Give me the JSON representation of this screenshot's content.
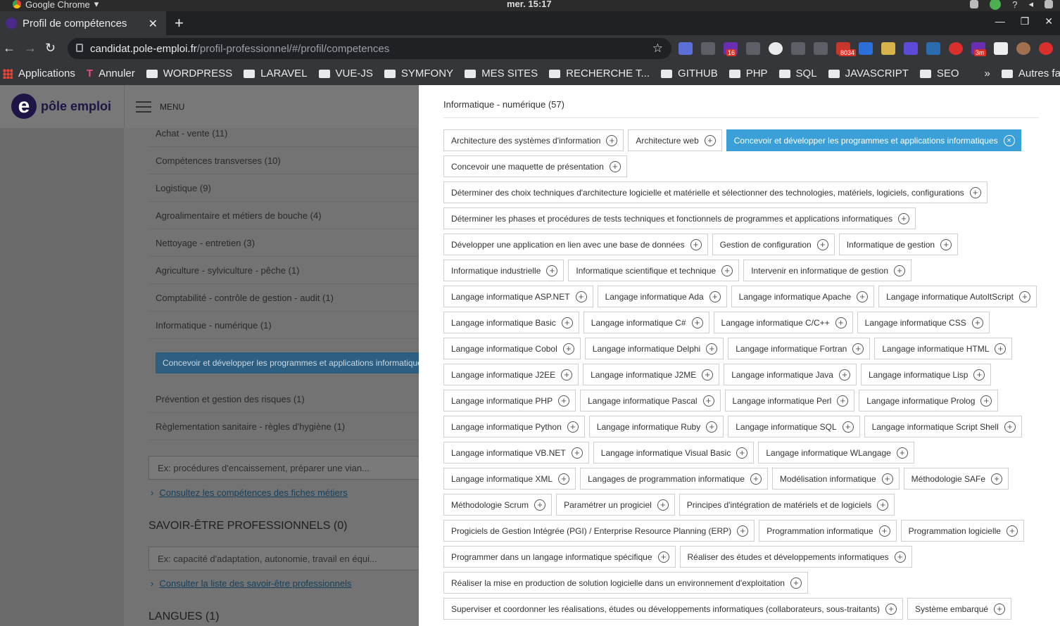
{
  "os": {
    "app_name": "Google Chrome",
    "time": "mer. 15:17"
  },
  "browser": {
    "tab_title": "Profil de compétences",
    "url_host": "candidat.pole-emploi.fr",
    "url_path": "/profil-professionnel/#/profil/competences",
    "extension_badges": {
      "mail": "8034",
      "purple": "16",
      "clock": "3m"
    }
  },
  "bookmarks": {
    "items": [
      "Applications",
      "Annuler",
      "WORDPRESS",
      "LARAVEL",
      "VUE-JS",
      "SYMFONY",
      "MES SITES",
      "RECHERCHE T...",
      "GITHUB",
      "PHP",
      "SQL",
      "JAVASCRIPT",
      "SEO"
    ],
    "more": "»",
    "others": "Autres favoris"
  },
  "site": {
    "logo_text": "pôle emploi",
    "logo_letter": "e",
    "menu_label": "MENU"
  },
  "left": {
    "categories": [
      "Achat - vente (11)",
      "Compétences transverses (10)",
      "Logistique (9)",
      "Agroalimentaire et métiers de bouche (4)",
      "Nettoyage - entretien (3)",
      "Agriculture - sylviculture - pêche (1)",
      "Comptabilité - contrôle de gestion - audit (1)",
      "Informatique - numérique (1)"
    ],
    "selected_skill": "Concevoir et développer les programmes et applications informatiques",
    "categories_after": [
      "Prévention et gestion des risques (1)",
      "Règlementation sanitaire - règles d'hygiène (1)"
    ],
    "skills_input_placeholder": "Ex: procédures d'encaissement, préparer une vian...",
    "skills_link": "Consultez les compétences des fiches métiers",
    "savoir_etre_title": "SAVOIR-ÊTRE PROFESSIONNELS (0)",
    "savoir_etre_placeholder": "Ex: capacité d'adaptation, autonomie, travail en équi...",
    "savoir_etre_link": "Consulter la liste des savoir-être professionnels",
    "langues_title": "LANGUES (1)"
  },
  "drawer": {
    "title": "Informatique - numérique (57)",
    "active_index": 2,
    "plus_glyph": "+",
    "remove_glyph": "×",
    "skills": [
      "Architecture des systèmes d'information",
      "Architecture web",
      "Concevoir et développer les programmes et applications informatiques",
      "Concevoir une maquette de présentation",
      "Déterminer des choix techniques d'architecture logicielle et matérielle et sélectionner des technologies, matériels, logiciels, configurations",
      "Déterminer les phases et procédures de tests techniques et fonctionnels de programmes et applications informatiques",
      "Développer une application en lien avec une base de données",
      "Gestion de configuration",
      "Informatique de gestion",
      "Informatique industrielle",
      "Informatique scientifique et technique",
      "Intervenir en informatique de gestion",
      "Langage informatique ASP.NET",
      "Langage informatique Ada",
      "Langage informatique Apache",
      "Langage informatique AutoItScript",
      "Langage informatique Basic",
      "Langage informatique C#",
      "Langage informatique C/C++",
      "Langage informatique CSS",
      "Langage informatique Cobol",
      "Langage informatique Delphi",
      "Langage informatique Fortran",
      "Langage informatique HTML",
      "Langage informatique J2EE",
      "Langage informatique J2ME",
      "Langage informatique Java",
      "Langage informatique Lisp",
      "Langage informatique PHP",
      "Langage informatique Pascal",
      "Langage informatique Perl",
      "Langage informatique Prolog",
      "Langage informatique Python",
      "Langage informatique Ruby",
      "Langage informatique SQL",
      "Langage informatique Script Shell",
      "Langage informatique VB.NET",
      "Langage informatique Visual Basic",
      "Langage informatique WLangage",
      "Langage informatique XML",
      "Langages de programmation informatique",
      "Modélisation informatique",
      "Méthodologie SAFe",
      "Méthodologie Scrum",
      "Paramétrer un progiciel",
      "Principes d'intégration de matériels et de logiciels",
      "Progiciels de Gestion Intégrée (PGI) / Enterprise Resource Planning (ERP)",
      "Programmation informatique",
      "Programmation logicielle",
      "Programmer dans un langage informatique spécifique",
      "Réaliser des études et développements informatiques",
      "Réaliser la mise en production de solution logicielle dans un environnement d'exploitation",
      "Superviser et coordonner les réalisations, études ou développements informatiques (collaborateurs, sous-traitants)",
      "Système embarqué"
    ]
  }
}
